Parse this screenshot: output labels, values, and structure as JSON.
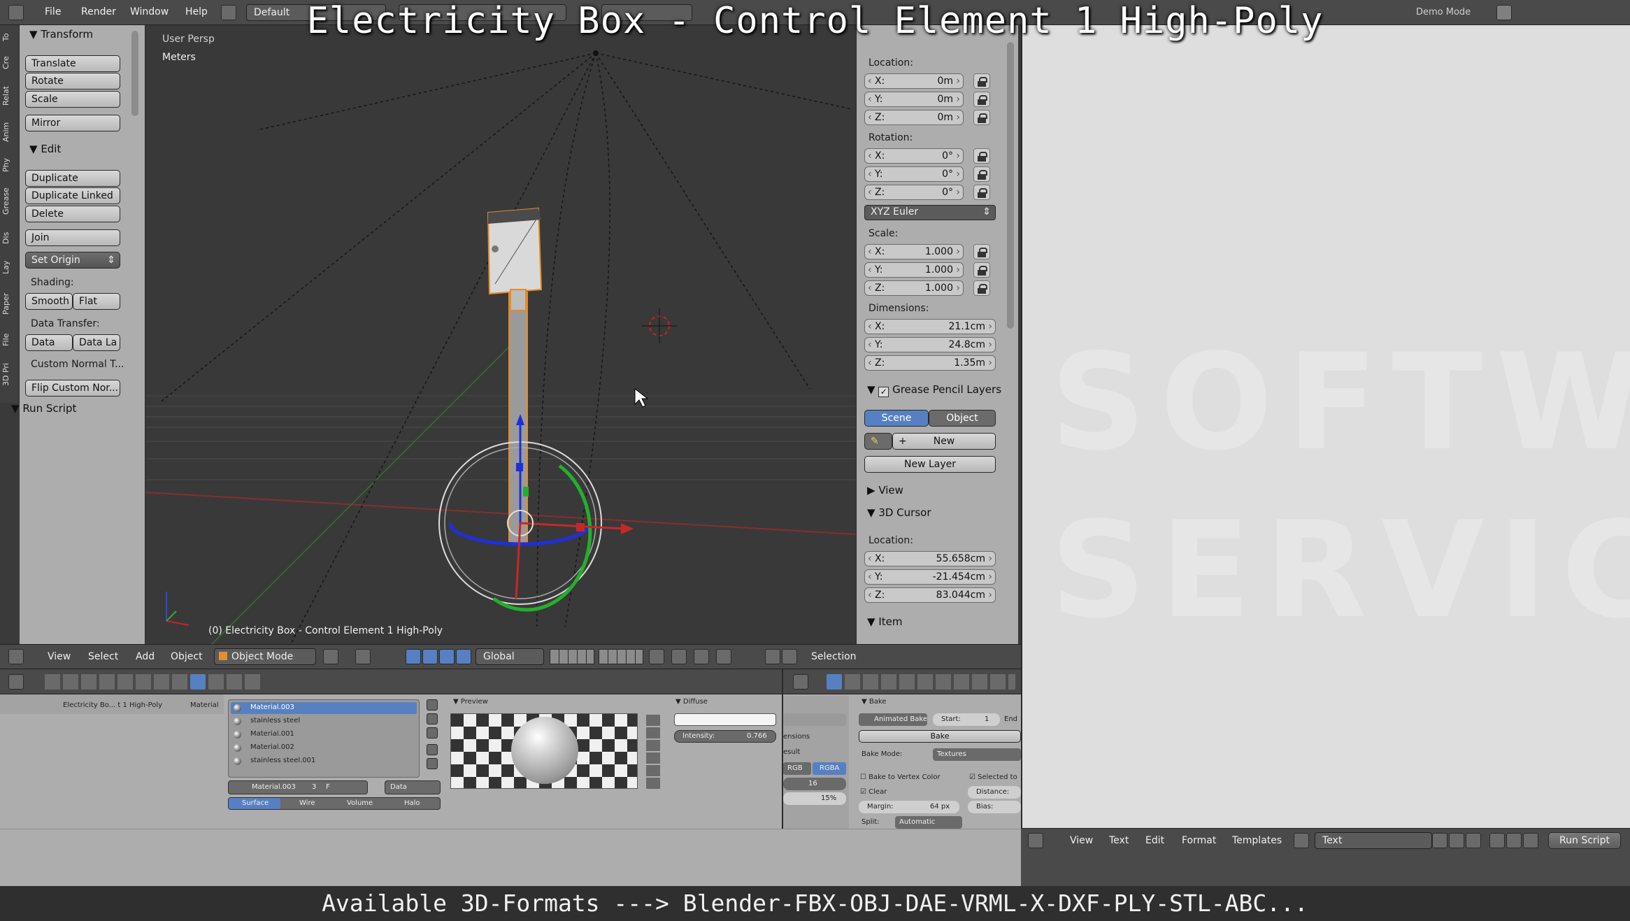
{
  "banner": {
    "title": "Electricity Box - Control Element 1 High-Poly",
    "footer": "Available 3D-Formats ---> Blender-FBX-OBJ-DAE-VRML-X-DXF-PLY-STL-ABC..."
  },
  "topbar": {
    "menus": [
      "File",
      "Render",
      "Window",
      "Help"
    ],
    "layout": "Default",
    "demo_mode": "Demo Mode"
  },
  "vertical_tabs": [
    "To",
    "Cre",
    "Relat",
    "Anim",
    "Phy",
    "Grease",
    "Dis",
    "Lay",
    "Paper",
    "File",
    "3D Pri"
  ],
  "toolshelf": {
    "transform_header": "Transform",
    "translate": "Translate",
    "rotate": "Rotate",
    "scale": "Scale",
    "mirror": "Mirror",
    "edit_header": "Edit",
    "duplicate": "Duplicate",
    "duplicate_linked": "Duplicate Linked",
    "delete": "Delete",
    "join": "Join",
    "set_origin": "Set Origin",
    "shading_label": "Shading:",
    "smooth": "Smooth",
    "flat": "Flat",
    "data_transfer_label": "Data Transfer:",
    "data": "Data",
    "data_la": "Data La",
    "custom_normal": "Custom Normal T...",
    "flip_custom": "Flip Custom Nor...",
    "run_script_header": "Run Script"
  },
  "viewport": {
    "view_label": "User Persp",
    "units": "Meters",
    "object_label": "(0) Electricity Box - Control Element 1 High-Poly"
  },
  "properties": {
    "location_label": "Location:",
    "location": [
      {
        "k": "X:",
        "v": "0m"
      },
      {
        "k": "Y:",
        "v": "0m"
      },
      {
        "k": "Z:",
        "v": "0m"
      }
    ],
    "rotation_label": "Rotation:",
    "rotation": [
      {
        "k": "X:",
        "v": "0°"
      },
      {
        "k": "Y:",
        "v": "0°"
      },
      {
        "k": "Z:",
        "v": "0°"
      }
    ],
    "rotation_mode": "XYZ Euler",
    "scale_label": "Scale:",
    "scale": [
      {
        "k": "X:",
        "v": "1.000"
      },
      {
        "k": "Y:",
        "v": "1.000"
      },
      {
        "k": "Z:",
        "v": "1.000"
      }
    ],
    "dimensions_label": "Dimensions:",
    "dimensions": [
      {
        "k": "X:",
        "v": "21.1cm"
      },
      {
        "k": "Y:",
        "v": "24.8cm"
      },
      {
        "k": "Z:",
        "v": "1.35m"
      }
    ],
    "grease_pencil_header": "Grease Pencil Layers",
    "scene_tab": "Scene",
    "object_tab": "Object",
    "new": "New",
    "new_layer": "New Layer",
    "view_header": "View",
    "cursor_header": "3D Cursor",
    "cursor_location_label": "Location:",
    "cursor": [
      {
        "k": "X:",
        "v": "55.658cm"
      },
      {
        "k": "Y:",
        "v": "-21.454cm"
      },
      {
        "k": "Z:",
        "v": "83.044cm"
      }
    ],
    "item_header": "Item"
  },
  "viewport_header": {
    "menus": [
      "View",
      "Select",
      "Add",
      "Object"
    ],
    "mode": "Object Mode",
    "orientation": "Global",
    "selection": "Selection"
  },
  "material_panel": {
    "breadcrumb": "Electricity Bo... t 1 High-Poly",
    "material_tab": "Material",
    "materials": [
      "Material.003",
      "stainless steel",
      "Material.001",
      "Material.002",
      "stainless steel.001"
    ],
    "selected_material": "Material.003",
    "users": "3",
    "users_flag": "F",
    "data_select": "Data",
    "tabs": [
      "Surface",
      "Wire",
      "Volume",
      "Halo"
    ],
    "preview_header": "Preview",
    "diffuse_header": "Diffuse",
    "intensity_label": "Intensity:",
    "intensity_value": "0.766"
  },
  "bake_panel": {
    "partial_labels": [
      "ensions",
      "esult"
    ],
    "rgb": "RGB",
    "rgba": "RGBA",
    "value_16": "16",
    "value_15": "15%",
    "bake_header": "Bake",
    "animated_bake": "Animated Bake",
    "start_label": "Start:",
    "start_value": "1",
    "end_label": "End",
    "bake_button": "Bake",
    "bake_mode_label": "Bake Mode:",
    "bake_mode": "Textures",
    "bake_vertex": "Bake to Vertex Color",
    "selected_to": "Selected to",
    "clear": "Clear",
    "distance": "Distance:",
    "margin_label": "Margin:",
    "margin_value": "64 px",
    "bias": "Bias:",
    "split_label": "Split:",
    "split_value": "Automatic"
  },
  "text_editor": {
    "menus": [
      "View",
      "Text",
      "Edit",
      "Format",
      "Templates"
    ],
    "text_name": "Text",
    "run_script": "Run Script",
    "watermark": "SOFTWARE SERVICE"
  }
}
